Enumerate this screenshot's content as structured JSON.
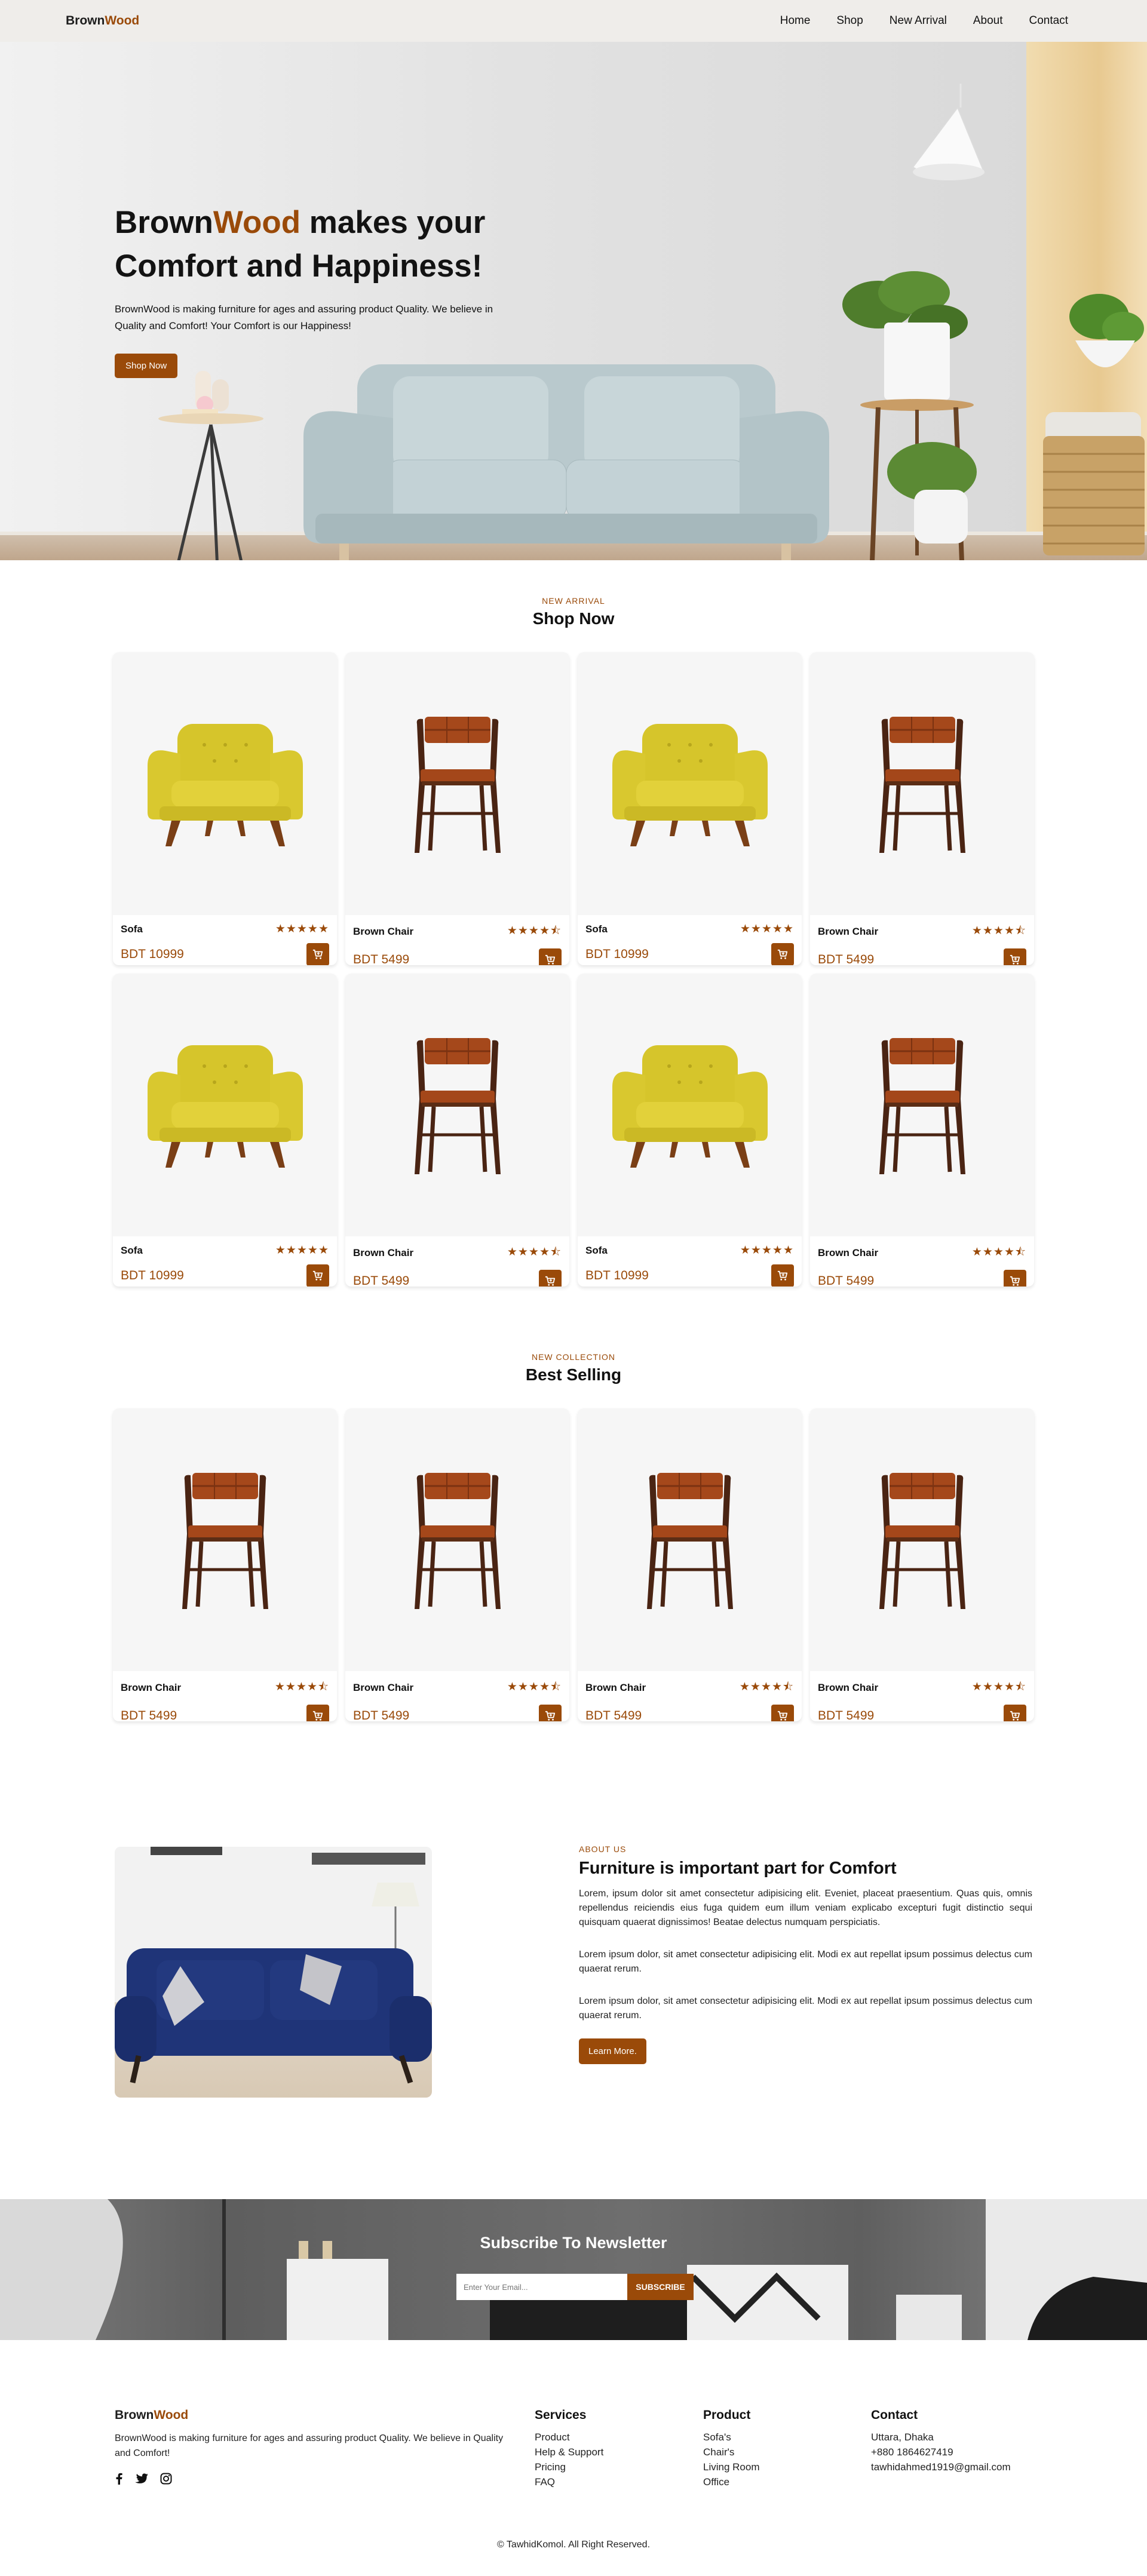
{
  "nav": {
    "brand_a": "Brown",
    "brand_b": "Wood",
    "links": [
      "Home",
      "Shop",
      "New Arrival",
      "About",
      "Contact"
    ]
  },
  "hero": {
    "title_a": "Brown",
    "title_b": "Wood",
    "title_c": " makes your",
    "title_d": "Comfort and Happiness!",
    "subtitle": "BrownWood is making furniture for ages and assuring product Quality. We believe in Quality and Comfort! Your Comfort is our Happiness!",
    "button": "Shop Now"
  },
  "shop_now": {
    "eyebrow": "NEW ARRIVAL",
    "title": "Shop Now",
    "products": [
      {
        "name": "Sofa",
        "price": "BDT 10999",
        "rating": 5,
        "kind": "sofa"
      },
      {
        "name": "Brown Chair",
        "price": "BDT 5499",
        "rating": 4.5,
        "kind": "chair"
      },
      {
        "name": "Sofa",
        "price": "BDT 10999",
        "rating": 5,
        "kind": "sofa"
      },
      {
        "name": "Brown Chair",
        "price": "BDT 5499",
        "rating": 4.5,
        "kind": "chair"
      },
      {
        "name": "Sofa",
        "price": "BDT 10999",
        "rating": 5,
        "kind": "sofa"
      },
      {
        "name": "Brown Chair",
        "price": "BDT 5499",
        "rating": 4.5,
        "kind": "chair"
      },
      {
        "name": "Sofa",
        "price": "BDT 10999",
        "rating": 5,
        "kind": "sofa"
      },
      {
        "name": "Brown Chair",
        "price": "BDT 5499",
        "rating": 4.5,
        "kind": "chair"
      }
    ]
  },
  "best_selling": {
    "eyebrow": "NEW COLLECTION",
    "title": "Best Selling",
    "products": [
      {
        "name": "Brown Chair",
        "price": "BDT 5499",
        "rating": 4.5,
        "kind": "chair"
      },
      {
        "name": "Brown Chair",
        "price": "BDT 5499",
        "rating": 4.5,
        "kind": "chair"
      },
      {
        "name": "Brown Chair",
        "price": "BDT 5499",
        "rating": 4.5,
        "kind": "chair"
      },
      {
        "name": "Brown Chair",
        "price": "BDT 5499",
        "rating": 4.5,
        "kind": "chair"
      }
    ]
  },
  "about": {
    "eyebrow": "ABOUT US",
    "title": "Furniture is important part for Comfort",
    "p1": "Lorem, ipsum dolor sit amet consectetur adipisicing elit. Eveniet, placeat praesentium. Quas quis, omnis repellendus reiciendis eius fuga quidem eum illum veniam explicabo excepturi fugit distinctio sequi quisquam quaerat dignissimos! Beatae delectus numquam perspiciatis.",
    "p2": "Lorem ipsum dolor, sit amet consectetur adipisicing elit. Modi ex aut repellat ipsum possimus delectus cum quaerat rerum.",
    "p3": "Lorem ipsum dolor, sit amet consectetur adipisicing elit. Modi ex aut repellat ipsum possimus delectus cum quaerat rerum.",
    "button": "Learn More."
  },
  "newsletter": {
    "title": "Subscribe To Newsletter",
    "placeholder": "Enter Your Email...",
    "button": "SUBSCRIBE"
  },
  "footer": {
    "brand_a": "Brown",
    "brand_b": "Wood",
    "description": "BrownWood is making furniture for ages and assuring product Quality. We believe in Quality and Comfort!",
    "services": {
      "title": "Services",
      "items": [
        "Product",
        "Help & Support",
        "Pricing",
        "FAQ"
      ]
    },
    "product": {
      "title": "Product",
      "items": [
        "Sofa's",
        "Chair's",
        "Living Room",
        "Office"
      ]
    },
    "contact": {
      "title": "Contact",
      "items": [
        "Uttara, Dhaka",
        "+880 1864627419",
        "tawhidahmed1919@gmail.com"
      ]
    },
    "copyright": "© TawhidKomol. All Right Reserved."
  },
  "colors": {
    "accent": "#9a4a09",
    "nav_bg": "#efedea",
    "card_img_bg": "#f6f6f6"
  }
}
